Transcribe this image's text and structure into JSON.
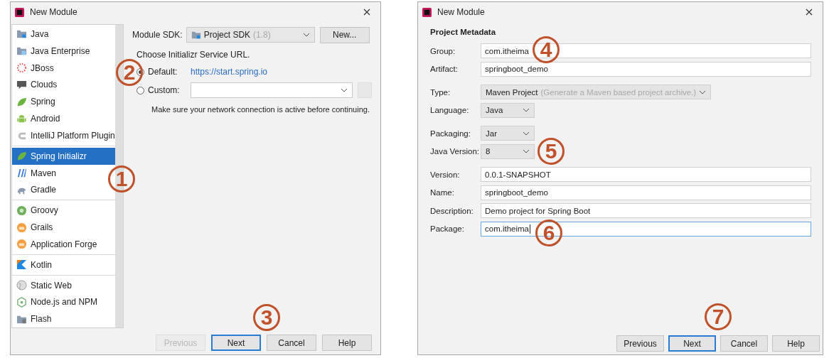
{
  "left_dialog": {
    "title": "New Module",
    "sidebar": {
      "groups": [
        {
          "items": [
            {
              "label": "Java",
              "selected": false
            },
            {
              "label": "Java Enterprise",
              "selected": false
            },
            {
              "label": "JBoss",
              "selected": false
            },
            {
              "label": "Clouds",
              "selected": false
            },
            {
              "label": "Spring",
              "selected": false
            },
            {
              "label": "Android",
              "selected": false
            },
            {
              "label": "IntelliJ Platform Plugin",
              "selected": false
            }
          ]
        },
        {
          "items": [
            {
              "label": "Spring Initializr",
              "selected": true
            },
            {
              "label": "Maven",
              "selected": false
            },
            {
              "label": "Gradle",
              "selected": false
            }
          ]
        },
        {
          "items": [
            {
              "label": "Groovy",
              "selected": false
            },
            {
              "label": "Grails",
              "selected": false
            },
            {
              "label": "Application Forge",
              "selected": false
            }
          ]
        },
        {
          "items": [
            {
              "label": "Kotlin",
              "selected": false
            }
          ]
        },
        {
          "items": [
            {
              "label": "Static Web",
              "selected": false
            },
            {
              "label": "Node.js and NPM",
              "selected": false
            },
            {
              "label": "Flash",
              "selected": false
            }
          ]
        }
      ]
    },
    "module_sdk": {
      "label": "Module SDK:",
      "value": "Project SDK",
      "version": "(1.8)"
    },
    "new_button": "New...",
    "service_url": {
      "heading": "Choose Initializr Service URL.",
      "options": [
        {
          "label": "Default:",
          "selected": true,
          "kind": "link",
          "value": "https://start.spring.io"
        },
        {
          "label": "Custom:",
          "selected": false,
          "kind": "combo"
        }
      ],
      "note": "Make sure your network connection is active before continuing."
    },
    "buttons": [
      {
        "label": "Previous",
        "disabled": true,
        "default": false
      },
      {
        "label": "Next",
        "disabled": false,
        "default": true
      },
      {
        "label": "Cancel",
        "disabled": false,
        "default": false
      },
      {
        "label": "Help",
        "disabled": false,
        "default": false
      }
    ]
  },
  "right_dialog": {
    "title": "New Module",
    "section": "Project Metadata",
    "field_groups": [
      {
        "fields": [
          {
            "label": "Group:",
            "kind": "text",
            "value": "com.itheima",
            "focused": false
          },
          {
            "label": "Artifact:",
            "kind": "text",
            "value": "springboot_demo",
            "focused": false
          }
        ]
      },
      {
        "fields": [
          {
            "label": "Type:",
            "kind": "select",
            "value": "Maven Project",
            "hint": "(Generate a Maven based project archive.)"
          },
          {
            "label": "Language:",
            "kind": "select",
            "value": "Java"
          }
        ]
      },
      {
        "fields": [
          {
            "label": "Packaging:",
            "kind": "select",
            "value": "Jar"
          },
          {
            "label": "Java Version:",
            "kind": "select",
            "value": "8"
          }
        ]
      },
      {
        "fields": [
          {
            "label": "Version:",
            "kind": "text",
            "value": "0.0.1-SNAPSHOT",
            "focused": false
          },
          {
            "label": "Name:",
            "kind": "text",
            "value": "springboot_demo",
            "focused": false
          },
          {
            "label": "Description:",
            "kind": "text",
            "value": "Demo project for Spring Boot",
            "focused": false
          },
          {
            "label": "Package:",
            "kind": "text",
            "value": "com.itheima",
            "focused": true
          }
        ]
      }
    ],
    "buttons": [
      {
        "label": "Previous",
        "disabled": false,
        "default": false
      },
      {
        "label": "Next",
        "disabled": false,
        "default": true
      },
      {
        "label": "Cancel",
        "disabled": false,
        "default": false
      },
      {
        "label": "Help",
        "disabled": false,
        "default": false
      }
    ]
  },
  "callouts": [
    {
      "label": "1"
    },
    {
      "label": "2"
    },
    {
      "label": "3"
    },
    {
      "label": "4"
    },
    {
      "label": "5"
    },
    {
      "label": "6"
    },
    {
      "label": "7"
    }
  ]
}
